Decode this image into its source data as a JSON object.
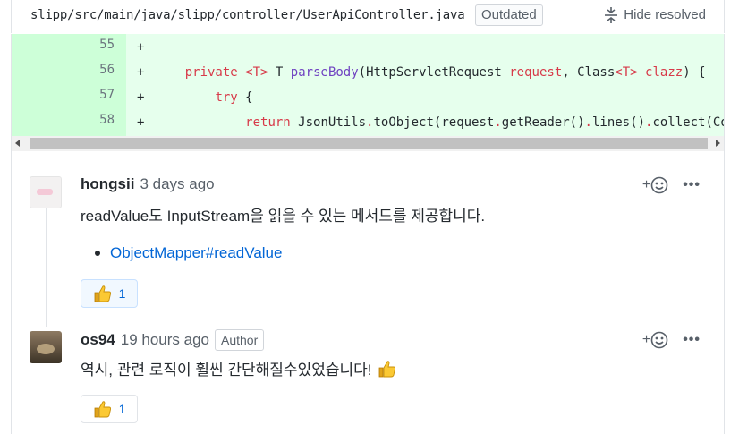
{
  "file": {
    "path": "slipp/src/main/java/slipp/controller/UserApiController.java",
    "outdated_label": "Outdated",
    "hide_resolved_label": "Hide resolved",
    "fold_icon": "fold-icon"
  },
  "diff": {
    "lines": [
      {
        "number": "55",
        "marker": "+",
        "code": ""
      },
      {
        "number": "56",
        "marker": "+",
        "code": "    private <T> T parseBody(HttpServletRequest request, Class<T> clazz) {"
      },
      {
        "number": "57",
        "marker": "+",
        "code": "        try {"
      },
      {
        "number": "58",
        "marker": "+",
        "code": "            return JsonUtils.toObject(request.getReader().lines().collect(Coll"
      }
    ]
  },
  "comments": [
    {
      "author": "hongsii",
      "time": "3 days ago",
      "badge": "",
      "body": "readValue도 InputStream을 읽을 수 있는 메서드를 제공합니다.",
      "link": "ObjectMapper#readValue",
      "reaction": {
        "icon": "thumbs-up-icon",
        "count": "1"
      },
      "add_reaction_label": "+",
      "more_label": "•••"
    },
    {
      "author": "os94",
      "time": "19 hours ago",
      "badge": "Author",
      "body": "역시, 관련 로직이 훨씬 간단해질수있었습니다!",
      "reaction": {
        "icon": "thumbs-up-icon",
        "count": "1"
      },
      "add_reaction_label": "+",
      "more_label": "•••"
    }
  ],
  "colors": {
    "addition_bg": "#e6ffed",
    "addition_gutter": "#cdffd8",
    "link": "#0366d6",
    "keyword": "#d73a49",
    "function": "#6f42c1"
  }
}
